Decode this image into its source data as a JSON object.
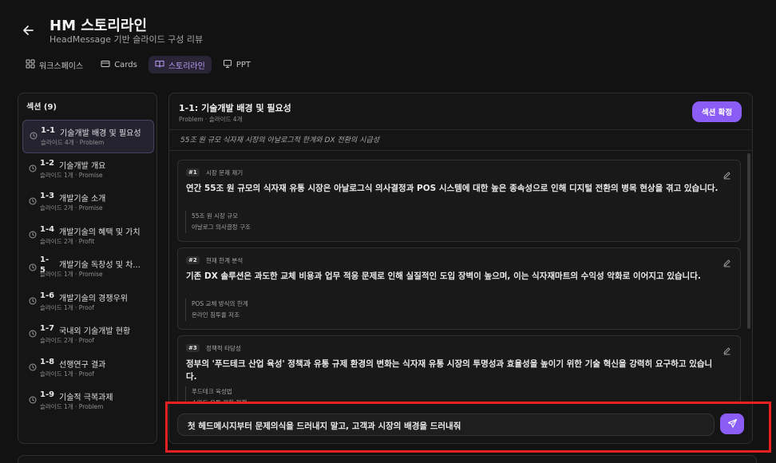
{
  "header": {
    "title": "HM 스토리라인",
    "subtitle": "HeadMessage 기반 슬라이드 구성 리뷰"
  },
  "tabs": [
    {
      "label": "워크스페이스",
      "icon": "grid-icon"
    },
    {
      "label": "Cards",
      "icon": "card-icon"
    },
    {
      "label": "스토리라인",
      "icon": "book-icon",
      "active": true
    },
    {
      "label": "PPT",
      "icon": "presentation-icon"
    }
  ],
  "sidebar": {
    "title": "섹션",
    "count": "(9)",
    "items": [
      {
        "num": "1-1",
        "title": "기술개발 배경 및 필요성",
        "meta": "슬라이드 4개 · Problem",
        "active": true
      },
      {
        "num": "1-2",
        "title": "기술개발 개요",
        "meta": "슬라이드 1개 · Promise"
      },
      {
        "num": "1-3",
        "title": "개발기술 소개",
        "meta": "슬라이드 2개 · Promise"
      },
      {
        "num": "1-4",
        "title": "개발기술의 혜택 및 가치",
        "meta": "슬라이드 2개 · Profit"
      },
      {
        "num": "1-5",
        "title": "개발기술 독창성 및 차...",
        "meta": "슬라이드 1개 · Promise",
        "tall": true
      },
      {
        "num": "1-6",
        "title": "개발기술의 경쟁우위",
        "meta": "슬라이드 1개 · Proof"
      },
      {
        "num": "1-7",
        "title": "국내외 기술개발 현황",
        "meta": "슬라이드 2개 · Proof"
      },
      {
        "num": "1-8",
        "title": "선행연구 결과",
        "meta": "슬라이드 1개 · Proof"
      },
      {
        "num": "1-9",
        "title": "기술적 극복과제",
        "meta": "슬라이드 1개 · Problem"
      }
    ]
  },
  "main": {
    "title": "1-1: 기술개발 배경 및 필요성",
    "meta": "Problem · 슬라이드 4개",
    "confirm_label": "섹션 확정",
    "summary": "55조 원 규모 식자재 시장의 아날로그적 한계와 DX 전환의 시급성",
    "cards": [
      {
        "badge": "#1",
        "label": "시장 문제 제기",
        "text": "연간 55조 원 규모의 식자재 유통 시장은 아날로그식 의사결정과 POS 시스템에 대한 높은 종속성으로 인해 디지털 전환의 병목 현상을 겪고 있습니다.",
        "tags": [
          "55조 원 시장 규모",
          "아날로그 의사결정 구조"
        ]
      },
      {
        "badge": "#2",
        "label": "현재 한계 분석",
        "text": "기존 DX 솔루션은 과도한 교체 비용과 업무 적응 문제로 인해 실질적인 도입 장벽이 높으며, 이는 식자재마트의 수익성 악화로 이어지고 있습니다.",
        "tags": [
          "POS 교체 방식의 한계",
          "온라인 침투율 저조"
        ]
      },
      {
        "badge": "#3",
        "label": "정책적 타당성",
        "text": "정부의 '푸드테크 산업 육성' 정책과 유통 규제 환경의 변화는 식자재 유통 시장의 투명성과 효율성을 높이기 위한 기술 혁신을 강력히 요구하고 있습니다.",
        "tags": [
          "푸드테크 육성법",
          "스마트 유통 전환 정책"
        ]
      }
    ],
    "composer_text": "첫 헤드메시지부터 문제의식을 드러내지 말고, 고객과 시장의 배경을 드러내줘"
  }
}
